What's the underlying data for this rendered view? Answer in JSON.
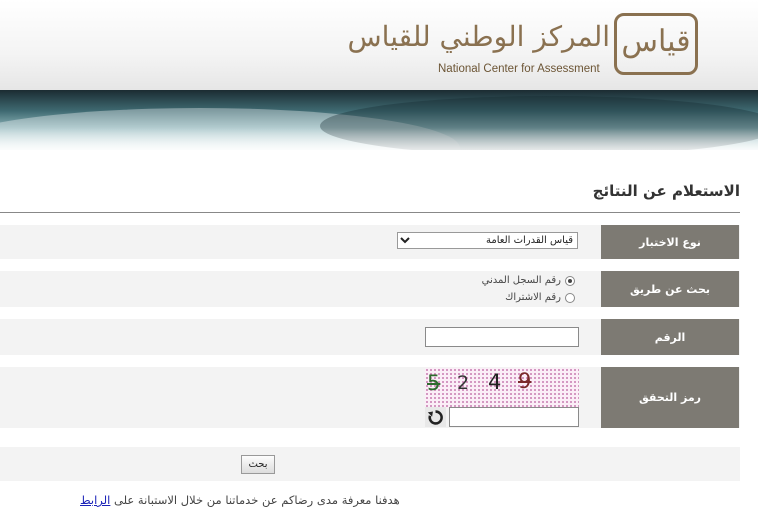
{
  "header": {
    "logo_arabic": "المركز الوطني للقياس",
    "logo_english": "National Center for Assessment",
    "logo_mark": "قياس"
  },
  "page": {
    "title": "الاستعلام عن النتائج"
  },
  "form": {
    "exam_type": {
      "label": "نوع الاختبار",
      "selected": "قياس القدرات العامة"
    },
    "search_by": {
      "label": "بحث عن طريق",
      "options": [
        {
          "label": "رقم السجل المدني",
          "checked": true
        },
        {
          "label": "رقم الاشتراك",
          "checked": false
        }
      ]
    },
    "number": {
      "label": "الرقم",
      "value": ""
    },
    "captcha": {
      "label": "رمز التحقق",
      "digits": [
        "5",
        "2",
        "4",
        "9"
      ],
      "value": ""
    },
    "submit_label": "بحث"
  },
  "footer": {
    "text": "هدفنا معرفة مدى رضاكم عن خدماتنا من خلال الاستبانة على",
    "link_label": "الرابط"
  },
  "colors": {
    "label_bg": "#7d7a73",
    "logo_brown": "#8a7150",
    "link": "#1a22b8"
  },
  "icons": [
    "dropdown-arrow-icon",
    "refresh-icon"
  ]
}
